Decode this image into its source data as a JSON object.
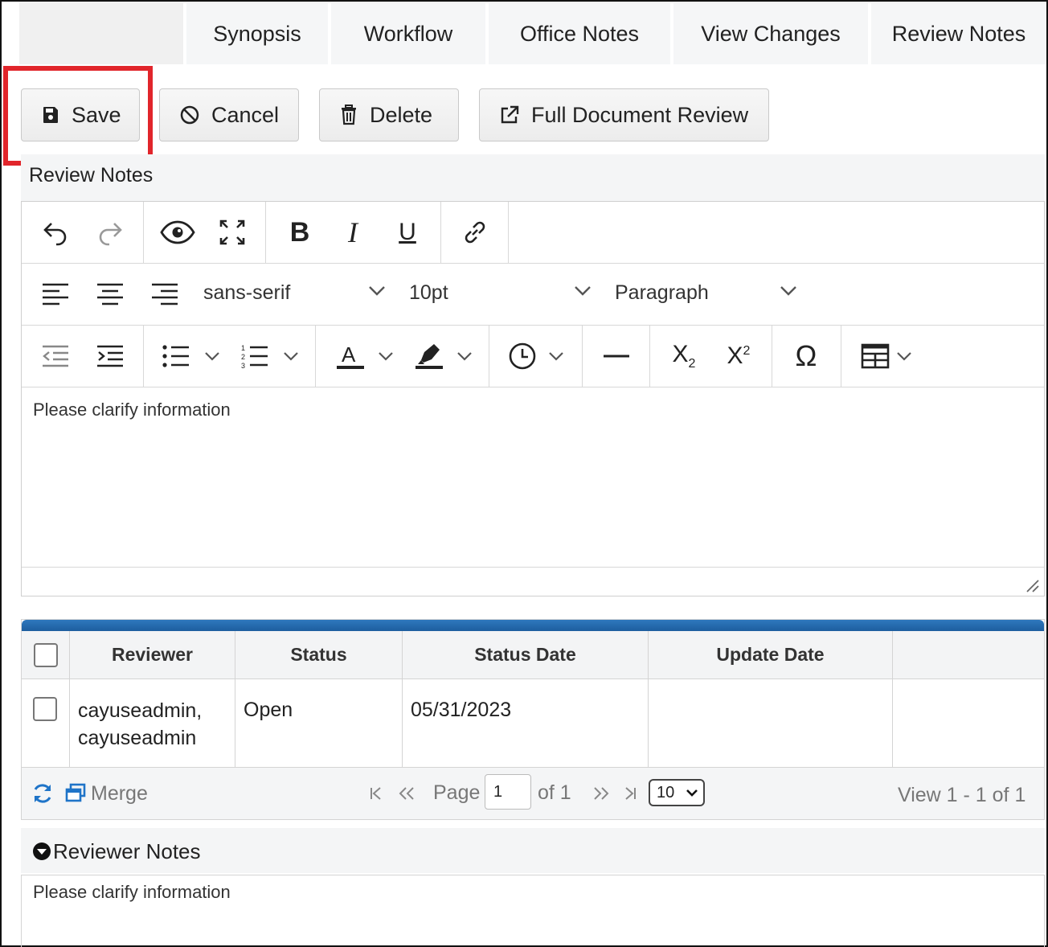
{
  "tabs": [
    {
      "label": "Synopsis"
    },
    {
      "label": "Workflow"
    },
    {
      "label": "Office Notes"
    },
    {
      "label": "View Changes"
    },
    {
      "label": "Review Notes"
    }
  ],
  "toolbar": {
    "save_label": "Save",
    "cancel_label": "Cancel",
    "delete_label": "Delete",
    "full_review_label": "Full Document Review"
  },
  "editor": {
    "section_title": "Review Notes",
    "font_family": "sans-serif",
    "font_size": "10pt",
    "block_format": "Paragraph",
    "content": "Please clarify information"
  },
  "grid": {
    "columns": [
      "Reviewer",
      "Status",
      "Status Date",
      "Update Date"
    ],
    "rows": [
      {
        "reviewer_line1": "cayuseadmin,",
        "reviewer_line2": "cayuseadmin",
        "status": "Open",
        "status_date": "05/31/2023",
        "update_date": ""
      }
    ],
    "pager": {
      "merge_label": "Merge",
      "page_label": "Page",
      "page_value": "1",
      "of_label": "of 1",
      "page_size": "10",
      "view_label": "View 1 - 1 of 1"
    }
  },
  "reviewer_notes": {
    "title": "Reviewer Notes",
    "content": "Please clarify information"
  },
  "colors": {
    "highlight": "#e1252b",
    "grid_header_bar": "#2f78bd",
    "refresh_icon": "#1f74c8"
  }
}
